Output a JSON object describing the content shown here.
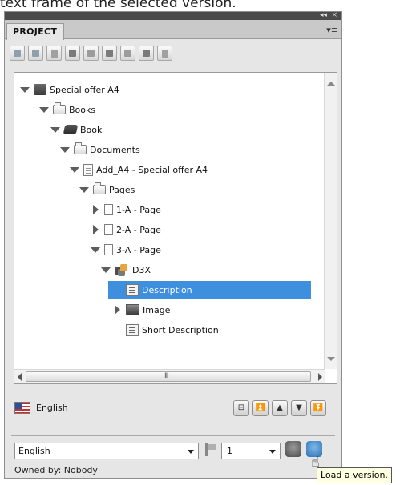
{
  "caption": "text frame of the selected version.",
  "panel": {
    "tab_label": "PROJECT",
    "collapse_glyph": "◂◂",
    "close_glyph": "×",
    "menu_glyph": "▾≡"
  },
  "toolbar": {
    "buttons": [
      "open-icon",
      "save-icon",
      "properties-icon",
      "add-icon",
      "copy-icon",
      "delete-icon",
      "new-page-icon",
      "export-icon",
      "refresh-icon"
    ]
  },
  "tree": {
    "nodes": [
      {
        "label": "Special offer A4",
        "icon": "project-icon",
        "toggle": "open",
        "selected": false
      },
      {
        "label": "Books",
        "icon": "folder-icon",
        "toggle": "open",
        "selected": false
      },
      {
        "label": "Book",
        "icon": "book-icon",
        "toggle": "open",
        "selected": false
      },
      {
        "label": "Documents",
        "icon": "folder-icon",
        "toggle": "open",
        "selected": false
      },
      {
        "label": "Add_A4 - Special offer A4",
        "icon": "document-icon",
        "toggle": "open",
        "selected": false
      },
      {
        "label": "Pages",
        "icon": "folder-icon",
        "toggle": "open",
        "selected": false
      },
      {
        "label": "1-A - Page",
        "icon": "page-icon",
        "toggle": "closed",
        "selected": false
      },
      {
        "label": "2-A - Page",
        "icon": "page-icon",
        "toggle": "closed",
        "selected": false
      },
      {
        "label": "3-A - Page",
        "icon": "page-icon",
        "toggle": "open",
        "selected": false
      },
      {
        "label": "D3X",
        "icon": "d3x-icon",
        "toggle": "open",
        "selected": false
      },
      {
        "label": "Description",
        "icon": "description-icon",
        "toggle": "none",
        "selected": true
      },
      {
        "label": "Image",
        "icon": "image-icon",
        "toggle": "closed",
        "selected": false
      },
      {
        "label": "Short Description",
        "icon": "description-icon",
        "toggle": "none",
        "selected": false
      }
    ],
    "hscroll_grip": "III"
  },
  "status": {
    "language": "English",
    "flag_icon": "us-flag-icon",
    "nav_buttons": [
      {
        "icon": "tree-view-icon",
        "glyph": "⊟"
      },
      {
        "icon": "first-icon",
        "glyph": "⏫"
      },
      {
        "icon": "up-icon",
        "glyph": "▲"
      },
      {
        "icon": "down-icon",
        "glyph": "▼"
      },
      {
        "icon": "last-icon",
        "glyph": "⏬"
      }
    ]
  },
  "bottom": {
    "language_select_value": "English",
    "version_select_value": "1",
    "owner_text": "Owned by: Nobody"
  },
  "tooltip": {
    "text": "Load a version."
  },
  "colors": {
    "selection": "#3e8fde",
    "panel_bg": "#e6e6e6",
    "header_bg": "#4a4a4a",
    "tooltip_bg": "#ffffe1"
  }
}
